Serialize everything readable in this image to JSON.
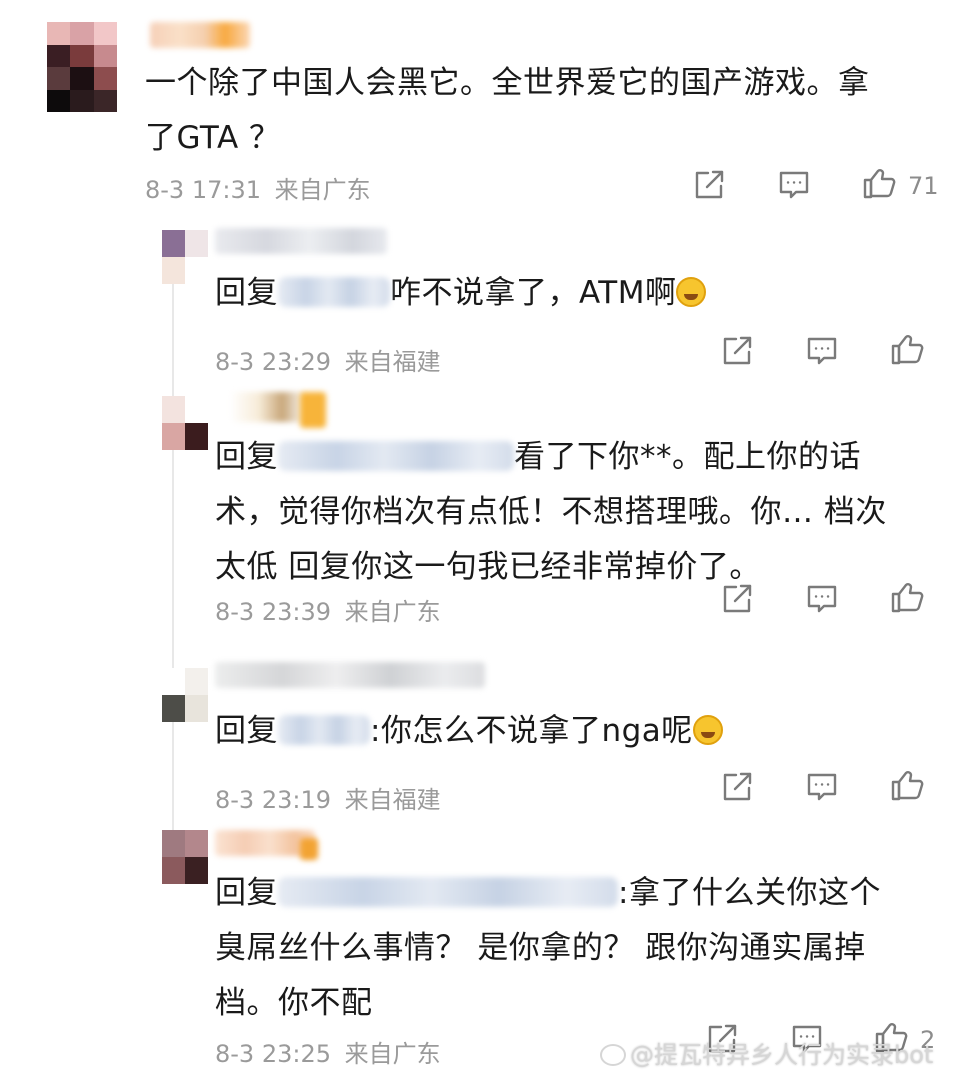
{
  "comments": [
    {
      "text": "一个除了中国人会黑它。全世界爱它的国产游戏。拿了GTA？",
      "line1": "一个除了中国人会黑它。全世界爱它的国产游戏。拿",
      "line2": "了GTA ？",
      "time": "8-3 17:31",
      "location": "来自广东",
      "like_count": "71"
    }
  ],
  "replies": [
    {
      "prefix": "回复",
      "suffix": "咋不说拿了，ATM啊",
      "time": "8-3 23:29",
      "location": "来自福建"
    },
    {
      "prefix": "回复",
      "line1_suffix": "看了下你**。配上你的话",
      "line2": "术，觉得你档次有点低！不想搭理哦。你… 档次",
      "line3": "太低 回复你这一句我已经非常掉价了。",
      "time": "8-3 23:39",
      "location": "来自广东"
    },
    {
      "prefix": "回复",
      "suffix": ":你怎么不说拿了nga呢",
      "time": "8-3 23:19",
      "location": "来自福建"
    },
    {
      "prefix": "回复",
      "line1_suffix": ":拿了什么关你这个",
      "line2": "臭屌丝什么事情？ 是你拿的？ 跟你沟通实属掉",
      "line3": "档。你不配",
      "time": "8-3 23:25",
      "location": "来自广东",
      "like_count": "2"
    }
  ],
  "watermark": "@提瓦特异乡人行为实录bot",
  "icons": [
    "share-icon",
    "comment-icon",
    "like-icon"
  ],
  "colors": {
    "meta_text": "#9a9a9a",
    "icon_stroke": "#7a7a7a",
    "divider": "#e8e8e8"
  }
}
